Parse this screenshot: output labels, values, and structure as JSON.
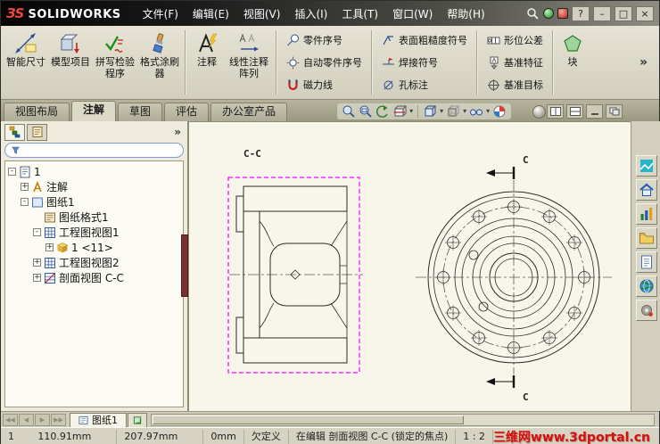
{
  "titlebar": {
    "logo_mark": "ЗS",
    "app_name": "SOLIDWORKS",
    "menus": [
      "文件(F)",
      "编辑(E)",
      "视图(V)",
      "插入(I)",
      "工具(T)",
      "窗口(W)",
      "帮助(H)"
    ]
  },
  "glyphs": {
    "help": "?",
    "dropdown": "▾",
    "minimize": "–",
    "maximize": "□",
    "close": "×",
    "overflow": "»",
    "panel_chevron": "»",
    "nav_first": "◀◀",
    "nav_prev": "◀",
    "nav_next": "▶",
    "nav_last": "▶▶",
    "plus": "+",
    "minus": "-"
  },
  "ribbon": {
    "buttons": {
      "smart_dimension": "智能尺寸",
      "model_items": "模型项目",
      "spell_checker": "拼写检验程序",
      "format_painter": "格式涂刷器",
      "note": "注释",
      "linear_note_pattern": "线性注释阵列",
      "balloon": "零件序号",
      "auto_balloon": "自动零件序号",
      "magnetic_line": "磁力线",
      "surface_finish": "表面粗糙度符号",
      "weld_symbol": "焊接符号",
      "hole_callout": "孔标注",
      "geometric_tolerance": "形位公差",
      "datum_feature": "基准特征",
      "datum_target": "基准目标",
      "block": "块"
    }
  },
  "tabs": [
    "视图布局",
    "注解",
    "草图",
    "评估",
    "办公室产品"
  ],
  "feature_tree": {
    "filter_value": "",
    "items": [
      {
        "label": "1"
      },
      {
        "label": "注解"
      },
      {
        "label": "图纸1"
      },
      {
        "label": "图纸格式1"
      },
      {
        "label": "工程图视图1"
      },
      {
        "label": "1 <11>"
      },
      {
        "label": "工程图视图2"
      },
      {
        "label": "剖面视图 C-C"
      }
    ]
  },
  "drawing": {
    "section_title": "C-C",
    "section_arrow_top": "C",
    "section_arrow_bottom": "C"
  },
  "sheetbar": {
    "sheet_tab": "图纸1"
  },
  "statusbar": {
    "sheet_number": "1",
    "x": "110.91mm",
    "y": "207.97mm",
    "z": "0mm",
    "state": "欠定义",
    "message": "在编辑 剖面视图 C-C (锁定的焦点)",
    "scale": "1 : 2",
    "watermark": "三维网www.3dportal.cn"
  }
}
